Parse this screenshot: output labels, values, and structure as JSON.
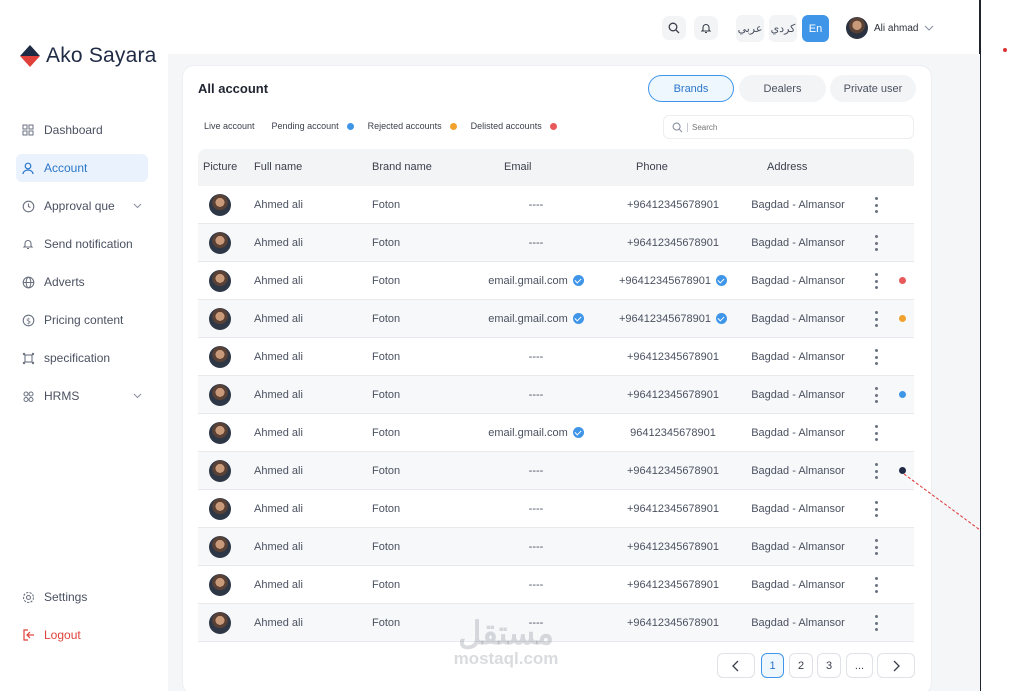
{
  "brand": {
    "name": "Ako Sayara"
  },
  "sidebar": {
    "items": [
      {
        "label": "Dashboard",
        "icon": "grid-icon"
      },
      {
        "label": "Account",
        "icon": "user-icon",
        "active": true
      },
      {
        "label": "Approval que",
        "icon": "clock-icon",
        "expandable": true
      },
      {
        "label": "Send notification",
        "icon": "bell-icon"
      },
      {
        "label": "Adverts",
        "icon": "globe-icon"
      },
      {
        "label": "Pricing content",
        "icon": "dollar-icon"
      },
      {
        "label": "specification",
        "icon": "spec-icon"
      },
      {
        "label": "HRMS",
        "icon": "people-icon",
        "expandable": true
      }
    ],
    "bottom": [
      {
        "label": "Settings",
        "icon": "gear-icon"
      },
      {
        "label": "Logout",
        "icon": "logout-icon"
      }
    ]
  },
  "topbar": {
    "languages": [
      "عربي",
      "كردي",
      "En"
    ],
    "active_language": "En",
    "user_name": "Ali ahmad"
  },
  "page": {
    "title": "All account",
    "tabs": [
      "Brands",
      "Dealers",
      "Private user"
    ],
    "active_tab": "Brands",
    "legend": {
      "live": "Live account",
      "pending": "Pending account",
      "rejected": "Rejected accounts",
      "delisted": "Delisted accounts"
    },
    "search_placeholder": "Search"
  },
  "colors": {
    "accent": "#3f96e8",
    "pending": "#3f96e8",
    "rejected": "#f0a22c",
    "delisted": "#e85a5a",
    "dark": "#1f2a44",
    "logout": "#e0413b"
  },
  "table": {
    "columns": [
      "Picture",
      "Full name",
      "Brand name",
      "Email",
      "Phone",
      "Address"
    ],
    "rows": [
      {
        "name": "Ahmed ali",
        "brand": "Foton",
        "email": "----",
        "email_verified": false,
        "phone": "+96412345678901",
        "phone_verified": false,
        "address": "Bagdad  - Almansor",
        "status": ""
      },
      {
        "name": "Ahmed ali",
        "brand": "Foton",
        "email": "----",
        "email_verified": false,
        "phone": "+96412345678901",
        "phone_verified": false,
        "address": "Bagdad  - Almansor",
        "status": ""
      },
      {
        "name": "Ahmed ali",
        "brand": "Foton",
        "email": "email.gmail.com",
        "email_verified": true,
        "phone": "+96412345678901",
        "phone_verified": true,
        "address": "Bagdad  - Almansor",
        "status": "delisted"
      },
      {
        "name": "Ahmed ali",
        "brand": "Foton",
        "email": "email.gmail.com",
        "email_verified": true,
        "phone": "+96412345678901",
        "phone_verified": true,
        "address": "Bagdad  - Almansor",
        "status": "rejected"
      },
      {
        "name": "Ahmed ali",
        "brand": "Foton",
        "email": "----",
        "email_verified": false,
        "phone": "+96412345678901",
        "phone_verified": false,
        "address": "Bagdad  - Almansor",
        "status": ""
      },
      {
        "name": "Ahmed ali",
        "brand": "Foton",
        "email": "----",
        "email_verified": false,
        "phone": "+96412345678901",
        "phone_verified": false,
        "address": "Bagdad  - Almansor",
        "status": "pending"
      },
      {
        "name": "Ahmed ali",
        "brand": "Foton",
        "email": "email.gmail.com",
        "email_verified": true,
        "phone": "96412345678901",
        "phone_verified": false,
        "address": "Bagdad  - Almansor",
        "status": ""
      },
      {
        "name": "Ahmed ali",
        "brand": "Foton",
        "email": "----",
        "email_verified": false,
        "phone": "+96412345678901",
        "phone_verified": false,
        "address": "Bagdad  - Almansor",
        "status": "dark"
      },
      {
        "name": "Ahmed ali",
        "brand": "Foton",
        "email": "----",
        "email_verified": false,
        "phone": "+96412345678901",
        "phone_verified": false,
        "address": "Bagdad  - Almansor",
        "status": ""
      },
      {
        "name": "Ahmed ali",
        "brand": "Foton",
        "email": "----",
        "email_verified": false,
        "phone": "+96412345678901",
        "phone_verified": false,
        "address": "Bagdad  - Almansor",
        "status": ""
      },
      {
        "name": "Ahmed ali",
        "brand": "Foton",
        "email": "----",
        "email_verified": false,
        "phone": "+96412345678901",
        "phone_verified": false,
        "address": "Bagdad  - Almansor",
        "status": ""
      },
      {
        "name": "Ahmed ali",
        "brand": "Foton",
        "email": "----",
        "email_verified": false,
        "phone": "+96412345678901",
        "phone_verified": false,
        "address": "Bagdad  - Almansor",
        "status": ""
      }
    ]
  },
  "pagination": {
    "prev_icon": "chevron-left-icon",
    "pages": [
      "1",
      "2",
      "3",
      "..."
    ],
    "current": "1",
    "next_icon": "chevron-right-icon"
  },
  "watermark": {
    "arabic": "مستقل",
    "latin": "mostaql.com"
  }
}
